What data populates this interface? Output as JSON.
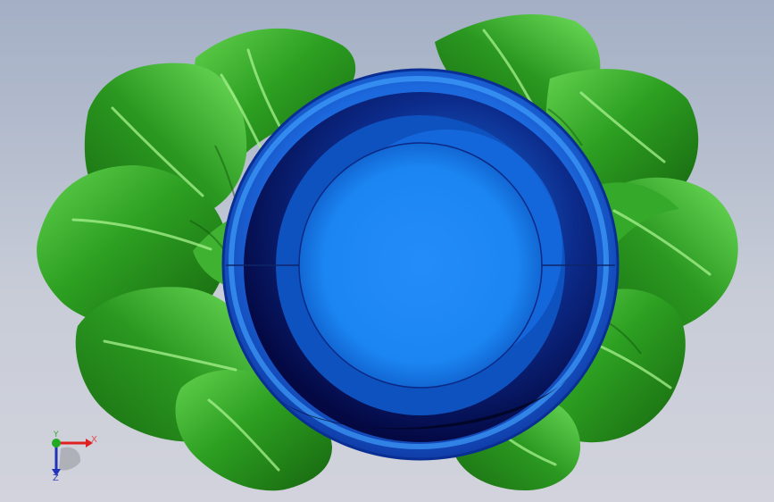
{
  "viewport": {
    "background_top": "#a3afc5",
    "background_bottom": "#d2d3dc"
  },
  "model": {
    "petal_color": "#2fa524",
    "petal_highlight": "#7fe06a",
    "petal_shadow": "#17650f",
    "cup_outer_color": "#1e73e8",
    "cup_ring_color": "#060c5c",
    "cup_center_color": "#1e86f5"
  },
  "triad": {
    "x_label": "X",
    "y_label": "Y",
    "z_label": "Z",
    "x_color": "#e02020",
    "y_color": "#22aa22",
    "z_color": "#2233bb"
  }
}
